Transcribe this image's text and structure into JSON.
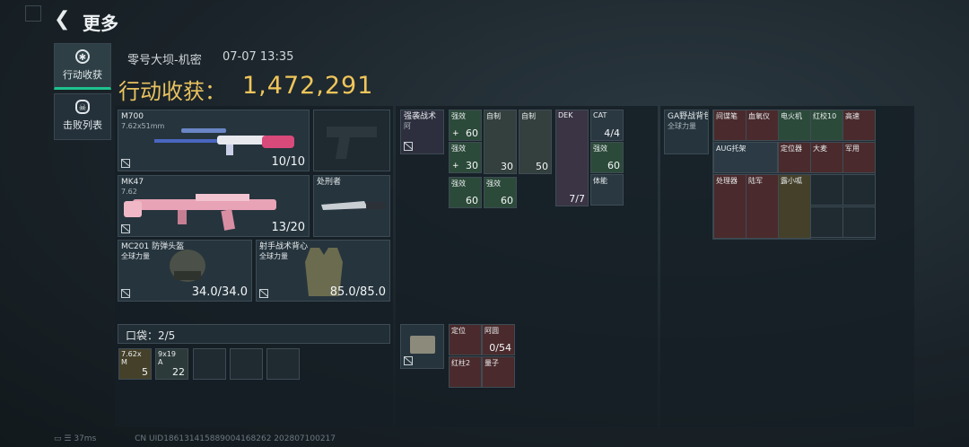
{
  "header": {
    "back_icon": "back-arrow-icon",
    "title": "更多"
  },
  "sidebar": {
    "tabs": [
      {
        "label": "行动收获",
        "icon": "target-icon",
        "active": true
      },
      {
        "label": "击败列表",
        "icon": "skull-icon",
        "active": false
      }
    ]
  },
  "match": {
    "map": "零号大坝-机密",
    "time": "07-07 13:35"
  },
  "summary": {
    "label": "行动收获：",
    "value": "1,472,291"
  },
  "loadout": {
    "primary": {
      "name": "M700",
      "caliber": "7.62x51mm",
      "ammo": "10/10"
    },
    "secondary": {
      "name": "MK47",
      "caliber": "7.62",
      "ammo": "13/20"
    },
    "melee": {
      "name": "处刑者"
    },
    "helmet": {
      "name": "MC201 防弹头盔",
      "sub": "全球力量",
      "durability": "34.0/34.0"
    },
    "armor": {
      "name": "射手战术背心",
      "sub": "全球力量",
      "durability": "85.0/85.0"
    }
  },
  "pocket": {
    "label": "口袋：2/5",
    "items": [
      {
        "name": "7.62x",
        "sub": "M",
        "qty": "5"
      },
      {
        "name": "9x19",
        "sub": "A",
        "qty": "22"
      }
    ]
  },
  "rig": {
    "name": "强袭战术",
    "sub": "阿",
    "items": [
      {
        "name": "强效",
        "qty": "60",
        "prefix": "+"
      },
      {
        "name": "自制",
        "qty": "30"
      },
      {
        "name": "自制",
        "qty": "50"
      },
      {
        "name": "强效",
        "qty": "30",
        "prefix": "+"
      },
      {
        "name": "强效",
        "qty": "60"
      },
      {
        "name": "强效",
        "qty": "60"
      }
    ],
    "dek": {
      "name": "DEK",
      "qty": "7/7"
    },
    "cat": {
      "name": "CAT",
      "qty": "4/4"
    },
    "cat_items": [
      {
        "name": "强效",
        "qty": "60"
      },
      {
        "name": "体能"
      }
    ]
  },
  "secure_case": {
    "items": [
      {
        "name": "定位"
      },
      {
        "name": "阿圆",
        "qty": "0/54"
      },
      {
        "name": "红柱2"
      },
      {
        "name": "量子"
      }
    ]
  },
  "backpack": {
    "name": "GA野战背包",
    "sub": "全球力量",
    "items": [
      {
        "name": "间谍笔"
      },
      {
        "name": "血氧仪"
      },
      {
        "name": "电火机"
      },
      {
        "name": "红校10"
      },
      {
        "name": "高速"
      },
      {
        "name": "AUG托架"
      },
      {
        "name": "定位器"
      },
      {
        "name": "大麦"
      },
      {
        "name": "军用"
      },
      {
        "name": "处理器"
      },
      {
        "name": "陆军"
      },
      {
        "name": "露小呱"
      }
    ]
  },
  "footer": {
    "ping": "37ms",
    "uid": "CN UID1861314158890041682​62 20280710​0217"
  }
}
